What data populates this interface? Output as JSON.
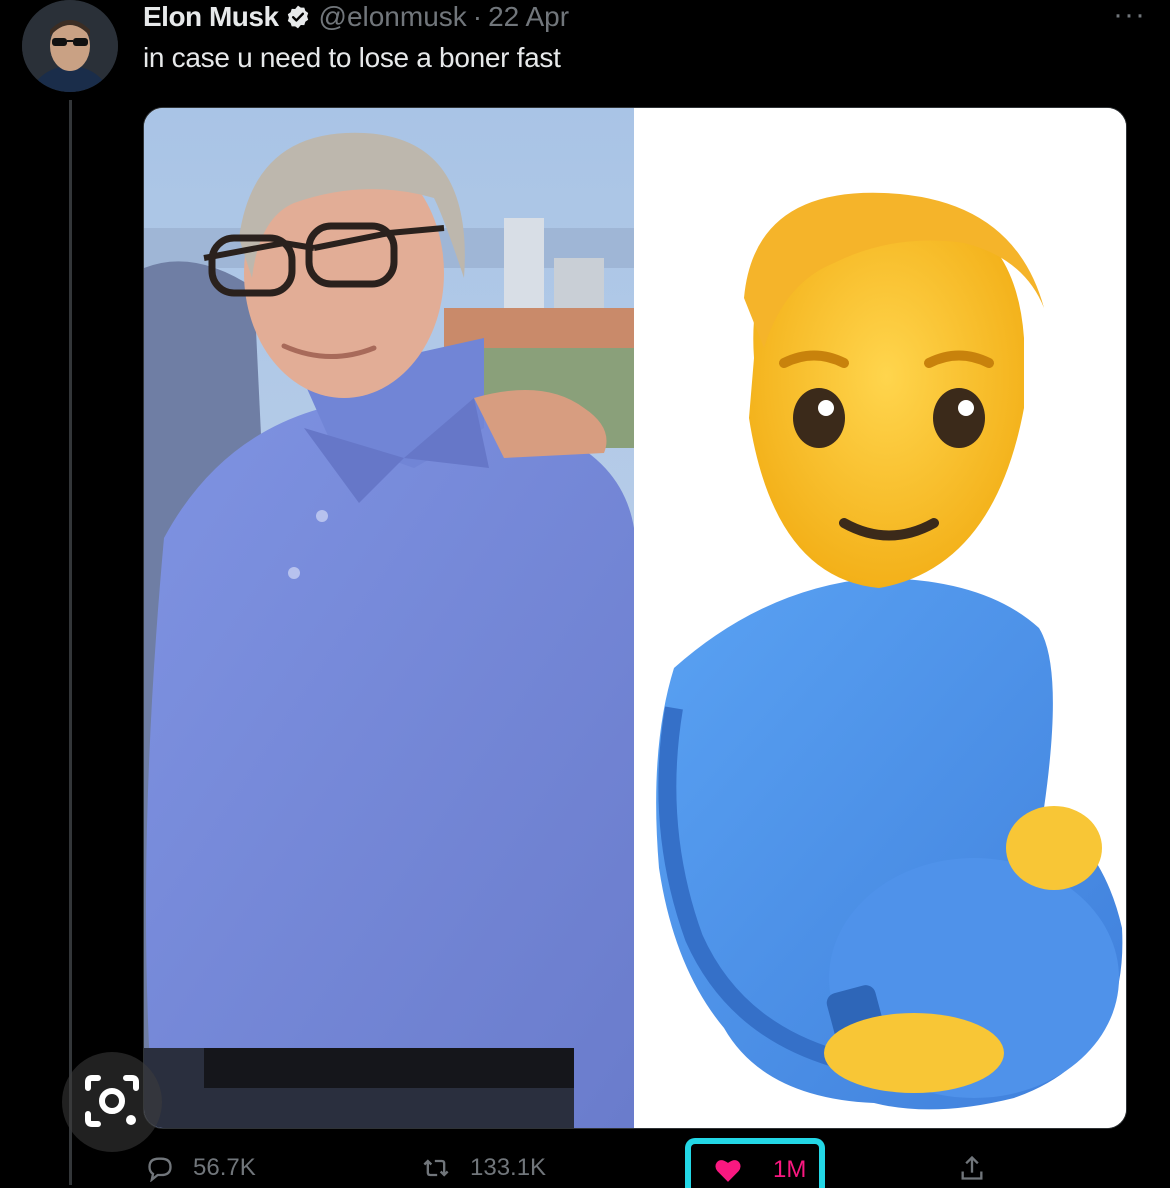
{
  "tweet": {
    "author_name": "Elon Musk",
    "handle": "@elonmusk",
    "separator": "·",
    "date": "22 Apr",
    "more_label": "···",
    "text": "in case u need to lose a boner fast"
  },
  "actions": {
    "replies": "56.7K",
    "retweets": "133.1K",
    "likes": "1M"
  },
  "icons": {
    "verified": "verified-badge-icon",
    "reply": "reply-icon",
    "retweet": "retweet-icon",
    "like": "heart-icon",
    "share": "share-icon",
    "lens": "google-lens-icon"
  },
  "colors": {
    "background": "#000000",
    "text_primary": "#e7e9ea",
    "text_secondary": "#71767b",
    "like": "#f91880",
    "highlight_box": "#23d7e6",
    "verified": "#e7e9ea"
  }
}
